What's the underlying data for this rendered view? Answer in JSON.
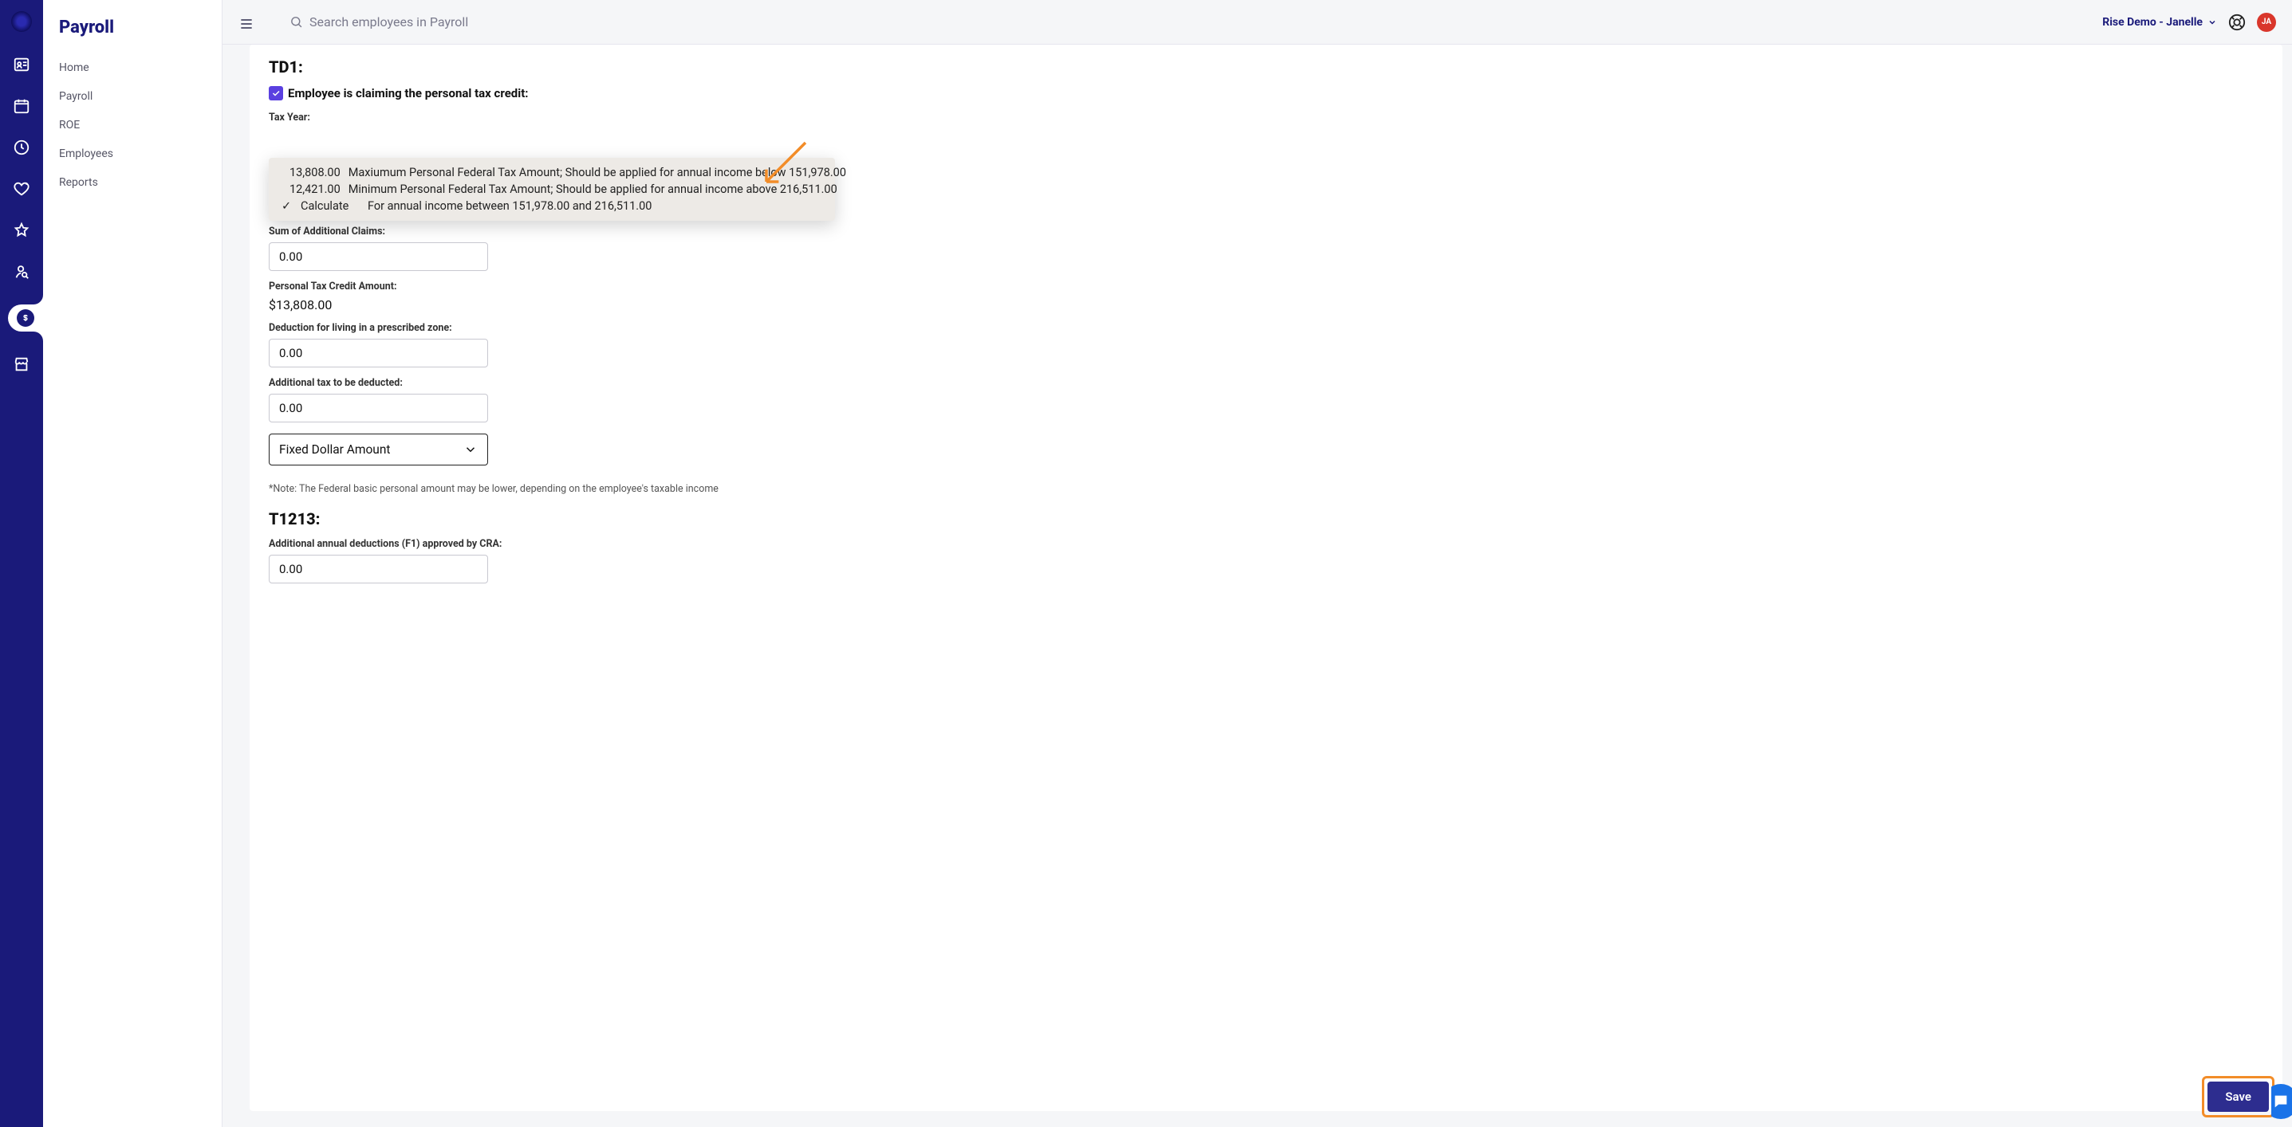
{
  "rail": {
    "icons": [
      "logo",
      "people",
      "calendar",
      "clock",
      "heart",
      "star",
      "person-search",
      "dollar",
      "store"
    ]
  },
  "sidebar": {
    "title": "Payroll",
    "items": [
      "Home",
      "Payroll",
      "ROE",
      "Employees",
      "Reports"
    ]
  },
  "topbar": {
    "search_placeholder": "Search employees in Payroll",
    "org_name": "Rise Demo - Janelle",
    "avatar_initials": "JA"
  },
  "form": {
    "td1_heading": "TD1:",
    "chk_label": "Employee is claiming the personal tax credit:",
    "chk_checked": true,
    "tax_year_label": "Tax Year:",
    "dropdown": {
      "rows": [
        {
          "selected": false,
          "col1": "13,808.00",
          "col2": "Maxiumum Personal Federal Tax Amount; Should be applied for annual income below 151,978.00"
        },
        {
          "selected": false,
          "col1": "12,421.00",
          "col2": "Minimum Personal Federal Tax Amount; Should be applied for annual income above 216,511.00"
        },
        {
          "selected": true,
          "col1": "Calculate",
          "col2": "For annual income between 151,978.00 and 216,511.00"
        }
      ]
    },
    "sum_claims_label": "Sum of Additional Claims:",
    "sum_claims_value": "0.00",
    "ptc_label": "Personal Tax Credit Amount:",
    "ptc_value": "$13,808.00",
    "zone_label": "Deduction for living in a prescribed zone:",
    "zone_value": "0.00",
    "addl_tax_label": "Additional tax to be deducted:",
    "addl_tax_value": "0.00",
    "deduct_type_label": "Fixed Dollar Amount",
    "note": "*Note: The Federal basic personal amount may be lower, depending on the employee's taxable income",
    "t1213_heading": "T1213:",
    "f1_label": "Additional annual deductions (F1) approved by CRA:",
    "f1_value": "0.00",
    "save_label": "Save"
  }
}
